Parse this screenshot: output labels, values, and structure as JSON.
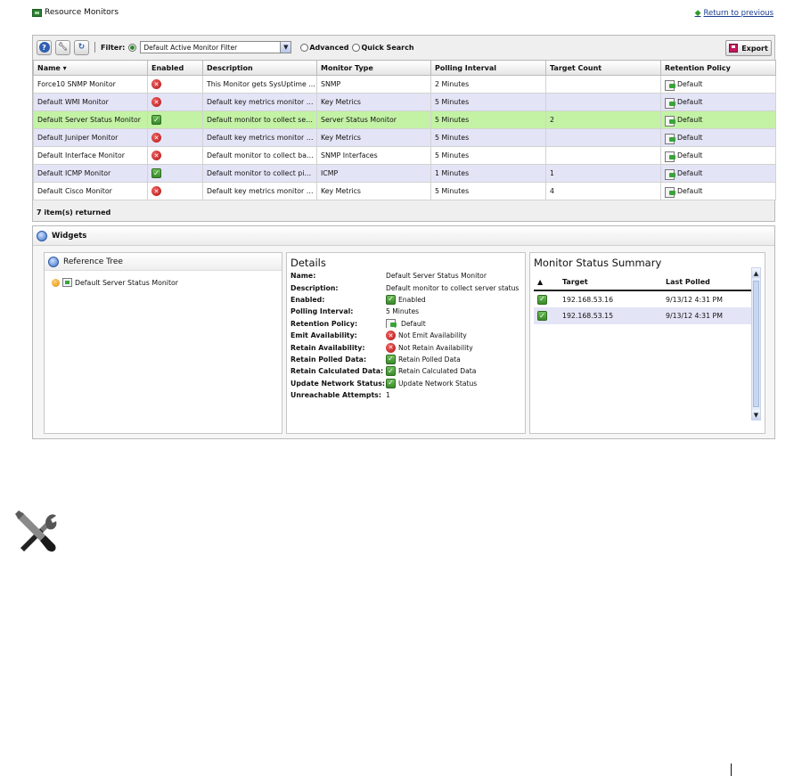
{
  "header": {
    "title": "Resource Monitors",
    "return_link": "Return to previous"
  },
  "toolbar": {
    "filter_label": "Filter:",
    "filter_value": "Default Active Monitor Filter",
    "advanced_label": "Advanced",
    "quick_search_label": "Quick Search",
    "export_label": "Export"
  },
  "table": {
    "columns": [
      "Name ▾",
      "Enabled",
      "Description",
      "Monitor Type",
      "Polling Interval",
      "Target Count",
      "Retention Policy"
    ],
    "rows": [
      {
        "name": "Force10 SNMP Monitor",
        "enabled": "x",
        "description": "This Monitor gets SysUptime ...",
        "type": "SNMP",
        "interval": "2 Minutes",
        "count": "",
        "policy": "Default"
      },
      {
        "name": "Default WMI Monitor",
        "enabled": "x",
        "description": "Default key metrics monitor fo...",
        "type": "Key Metrics",
        "interval": "5 Minutes",
        "count": "",
        "policy": "Default"
      },
      {
        "name": "Default Server Status Monitor",
        "enabled": "check",
        "description": "Default monitor to collect serv...",
        "type": "Server Status Monitor",
        "interval": "5 Minutes",
        "count": "2",
        "policy": "Default"
      },
      {
        "name": "Default Juniper Monitor",
        "enabled": "x",
        "description": "Default key metrics monitor fo...",
        "type": "Key Metrics",
        "interval": "5 Minutes",
        "count": "",
        "policy": "Default"
      },
      {
        "name": "Default Interface Monitor",
        "enabled": "x",
        "description": "Default monitor to collect ban...",
        "type": "SNMP Interfaces",
        "interval": "5 Minutes",
        "count": "",
        "policy": "Default"
      },
      {
        "name": "Default ICMP Monitor",
        "enabled": "check",
        "description": "Default monitor to collect ping...",
        "type": "ICMP",
        "interval": "1 Minutes",
        "count": "1",
        "policy": "Default"
      },
      {
        "name": "Default Cisco Monitor",
        "enabled": "x",
        "description": "Default key metrics monitor fo...",
        "type": "Key Metrics",
        "interval": "5 Minutes",
        "count": "4",
        "policy": "Default"
      }
    ],
    "status": "7 item(s) returned"
  },
  "widgets": {
    "title": "Widgets",
    "reference_tree": {
      "title": "Reference Tree",
      "node": "Default Server Status Monitor"
    },
    "details": {
      "title": "Details",
      "rows": [
        {
          "label": "Name:",
          "value": "Default Server Status Monitor",
          "icon": ""
        },
        {
          "label": "Description:",
          "value": "Default monitor to collect server status",
          "icon": ""
        },
        {
          "label": "Enabled:",
          "value": "Enabled",
          "icon": "check"
        },
        {
          "label": "Polling Interval:",
          "value": "5 Minutes",
          "icon": ""
        },
        {
          "label": "Retention Policy:",
          "value": "Default",
          "icon": "policy"
        },
        {
          "label": "Emit Availability:",
          "value": "Not Emit Availability",
          "icon": "x"
        },
        {
          "label": "Retain Availability:",
          "value": "Not Retain Availability",
          "icon": "x"
        },
        {
          "label": "Retain Polled Data:",
          "value": "Retain Polled Data",
          "icon": "check"
        },
        {
          "label": "Retain Calculated Data:",
          "value": "Retain Calculated Data",
          "icon": "check"
        },
        {
          "label": "Update Network Status:",
          "value": "Update Network Status",
          "icon": "check"
        },
        {
          "label": "Unreachable Attempts:",
          "value": "1",
          "icon": ""
        }
      ]
    },
    "monitor_status": {
      "title": "Monitor Status Summary",
      "columns": [
        "▲",
        "Target",
        "Last Polled"
      ],
      "rows": [
        {
          "status": "check",
          "target": "192.168.53.16",
          "last_polled": "9/13/12 4:31 PM"
        },
        {
          "status": "check",
          "target": "192.168.53.15",
          "last_polled": "9/13/12 4:31 PM"
        }
      ]
    }
  },
  "icons": {
    "help": "help-icon",
    "settings": "wrench-icon",
    "refresh": "refresh-icon",
    "export": "save-disk-icon",
    "tools": "tools-icon"
  },
  "colors": {
    "selected_row": "#c3f2a5",
    "alt_row": "#e4e4f7",
    "link": "#1a3d8f"
  }
}
